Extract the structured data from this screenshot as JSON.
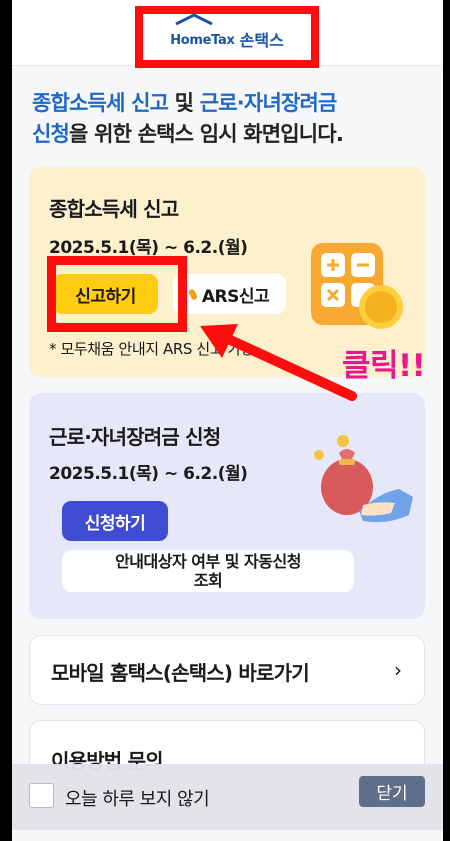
{
  "header": {
    "logo_en": "HomeTax",
    "logo_ko": "손택스"
  },
  "intro": {
    "part1": "종합소득세 신고",
    "part2": " 및 ",
    "part3": "근로·자녀장려금",
    "part4": "신청",
    "part5": "을 위한 손택스 임시 화면입니다."
  },
  "income_tax_card": {
    "title": "종합소득세 신고",
    "date": "2025.5.1(목) ~ 6.2.(월)",
    "file_button": "신고하기",
    "ars_button": "ARS신고",
    "note": "* 모두채움 안내지 ARS 신고 가능"
  },
  "incentive_card": {
    "title": "근로·자녀장려금 신청",
    "date": "2025.5.1(목) ~ 6.2.(월)",
    "apply_button": "신청하기",
    "lookup_button_line1": "안내대상자 여부 및 자동신청",
    "lookup_button_line2": "조회"
  },
  "mobile_link": {
    "label": "모바일 홈택스(손택스) 바로가기",
    "chevron": "›"
  },
  "inquiry": {
    "label": "이용방법 문의"
  },
  "bottom_bar": {
    "checkbox_label": "오늘 하루 보지 않기",
    "close_button": "닫기"
  },
  "annotation": {
    "text": "클릭!!",
    "color": "#e8188a",
    "box_color": "#ff0d0d"
  },
  "colors": {
    "brand_blue": "#1c55a8",
    "accent_blue": "#1f67c8",
    "yellow_button": "#ffcc0f",
    "blue_button": "#3f4bd0"
  }
}
